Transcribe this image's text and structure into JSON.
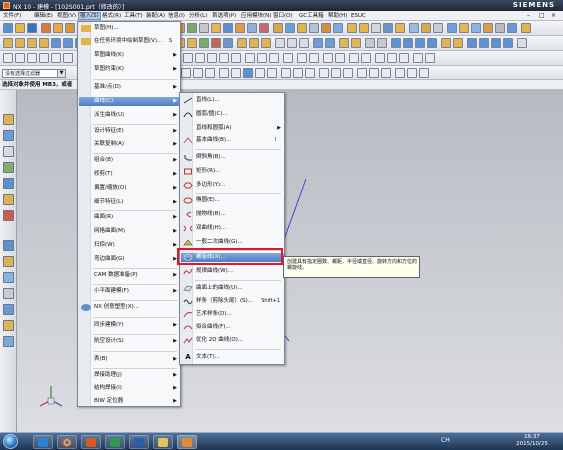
{
  "window": {
    "title": "NX 10 - 建模 - [102S001.prt（修改的）]",
    "brand": "SIEMENS"
  },
  "menubar": {
    "items": [
      "文件(F)",
      "编辑(E)",
      "视图(V)",
      "插入(S)",
      "格式(R)",
      "工具(T)",
      "装配(A)",
      "信息(I)",
      "分析(L)",
      "首选项(P)",
      "应用模块(N)",
      "窗口(O)",
      "GC工具箱",
      "帮助(H)",
      "ESUC"
    ],
    "active": "插入(S)"
  },
  "selection_filter": {
    "value": "没有选择过滤器"
  },
  "cue_line": "选择对象并使用 MB3，或者",
  "insert_menu": {
    "items": [
      {
        "label": "草图(H)...",
        "shortcut": "",
        "submenu": false
      },
      {
        "label": "在任务环境中绘制草图(V)...",
        "shortcut": "S",
        "submenu": false
      },
      {
        "label": "草图曲线(K)",
        "shortcut": "",
        "submenu": true
      },
      {
        "label": "草图约束(K)",
        "shortcut": "",
        "submenu": true
      },
      {
        "label": "基准/点(D)",
        "shortcut": "",
        "submenu": true
      },
      {
        "label": "曲线(C)",
        "shortcut": "",
        "submenu": true,
        "highlighted": true
      },
      {
        "label": "派生曲线(U)",
        "shortcut": "",
        "submenu": true
      },
      {
        "label": "设计特征(E)",
        "shortcut": "",
        "submenu": true
      },
      {
        "label": "关联复制(A)",
        "shortcut": "",
        "submenu": true
      },
      {
        "label": "组合(B)",
        "shortcut": "",
        "submenu": true
      },
      {
        "label": "修剪(T)",
        "shortcut": "",
        "submenu": true
      },
      {
        "label": "偏置/缩放(O)",
        "shortcut": "",
        "submenu": true
      },
      {
        "label": "细节特征(L)",
        "shortcut": "",
        "submenu": true
      },
      {
        "label": "曲面(R)",
        "shortcut": "",
        "submenu": true
      },
      {
        "label": "网格曲面(M)",
        "shortcut": "",
        "submenu": true
      },
      {
        "label": "扫掠(W)",
        "shortcut": "",
        "submenu": true
      },
      {
        "label": "弯边曲面(G)",
        "shortcut": "",
        "submenu": true
      },
      {
        "label": "CAM 数据准备(P)",
        "shortcut": "",
        "submenu": true
      },
      {
        "label": "小平面建模(F)",
        "shortcut": "",
        "submenu": true
      },
      {
        "label": "NX 创意塑型(X)...",
        "shortcut": "",
        "submenu": false
      },
      {
        "label": "同步建模(Y)",
        "shortcut": "",
        "submenu": true
      },
      {
        "label": "航空设计(S)",
        "shortcut": "",
        "submenu": true
      },
      {
        "label": "表(B)",
        "shortcut": "",
        "submenu": true
      },
      {
        "label": "焊接助理(J)",
        "shortcut": "",
        "submenu": true
      },
      {
        "label": "结构焊接(I)",
        "shortcut": "",
        "submenu": true
      },
      {
        "label": "BIW 定位器",
        "shortcut": "",
        "submenu": true
      }
    ]
  },
  "curve_menu": {
    "items": [
      {
        "label": "直线(L)...",
        "shortcut": "",
        "submenu": false
      },
      {
        "label": "圆弧/圆(C)...",
        "shortcut": "",
        "submenu": false
      },
      {
        "label": "直线和圆弧(A)",
        "shortcut": "",
        "submenu": true
      },
      {
        "label": "基本曲线(B)...",
        "shortcut": "I",
        "submenu": false
      },
      {
        "label": "倒斜角(B)...",
        "shortcut": "",
        "submenu": false
      },
      {
        "label": "矩形(R)...",
        "shortcut": "",
        "submenu": false
      },
      {
        "label": "多边形(Y)...",
        "shortcut": "",
        "submenu": false
      },
      {
        "label": "椭圆(E)...",
        "shortcut": "",
        "submenu": false
      },
      {
        "label": "抛物线(B)...",
        "shortcut": "",
        "submenu": false
      },
      {
        "label": "双曲线(H)...",
        "shortcut": "",
        "submenu": false
      },
      {
        "label": "一般二次曲线(G)...",
        "shortcut": "",
        "submenu": false
      },
      {
        "label": "螺旋线(X)...",
        "shortcut": "",
        "submenu": false,
        "highlighted": true
      },
      {
        "label": "规律曲线(W)...",
        "shortcut": "",
        "submenu": false
      },
      {
        "label": "曲面上的曲线(U)...",
        "shortcut": "",
        "submenu": false
      },
      {
        "label": "样条（剪除头尾）(S)...",
        "shortcut": "Shift+1",
        "submenu": false
      },
      {
        "label": "艺术样条(D)...",
        "shortcut": "",
        "submenu": false
      },
      {
        "label": "拟合曲线(F)...",
        "shortcut": "",
        "submenu": false
      },
      {
        "label": "优化 2D 曲线(O)...",
        "shortcut": "",
        "submenu": false
      },
      {
        "label": "文本(T)...",
        "shortcut": "",
        "submenu": false
      }
    ]
  },
  "tooltip": "创建具有指定圈数、螺距、半径或直径、旋转方向和方位的螺旋线。",
  "taskbar": {
    "lang": "CH",
    "time": "16:37",
    "date": "2015/10/25"
  },
  "colors": {
    "menu_highlight": "#5a87c8",
    "emphasis_box": "#e0162b",
    "curve_line": "#3a47d8"
  }
}
